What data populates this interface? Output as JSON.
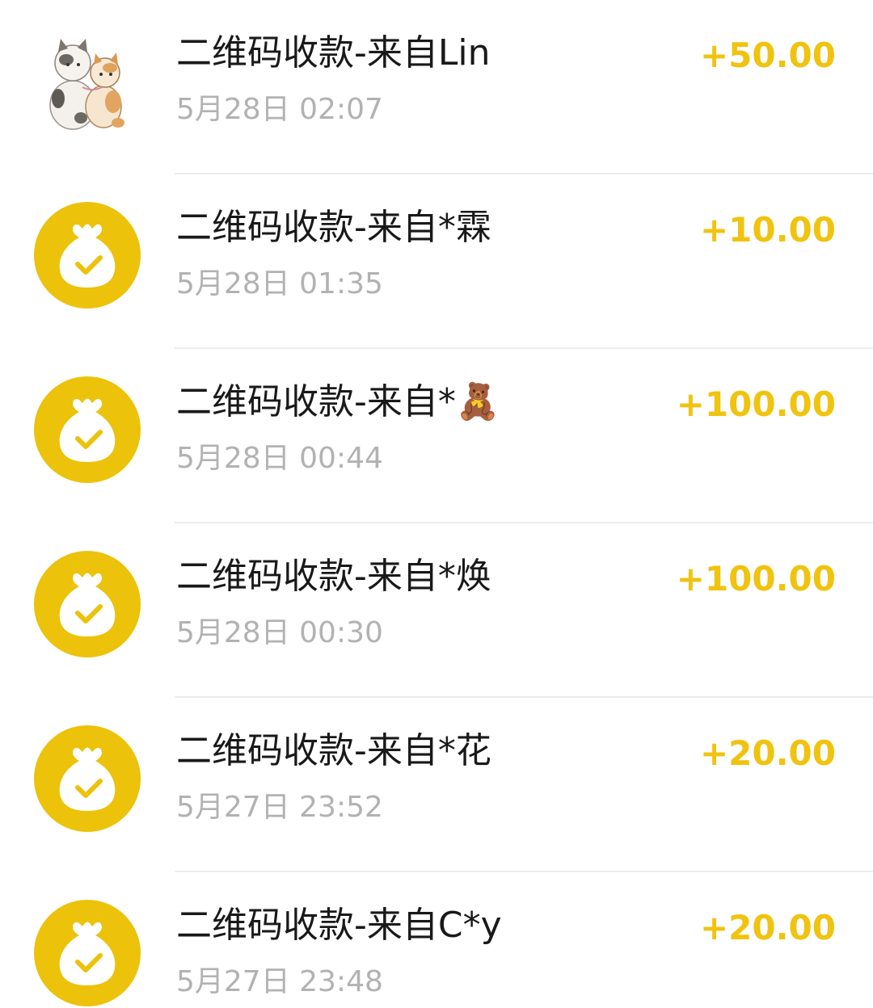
{
  "colors": {
    "accent": "#F0C30F",
    "title_text": "#191919",
    "time_text": "#B2B2B2",
    "divider": "#ECECEC"
  },
  "transactions": [
    {
      "avatar": "cat-photo-avatar",
      "title": "二维码收款-来自Lin",
      "time": "5月28日 02:07",
      "amount": "+50.00"
    },
    {
      "avatar": "money-bag-icon",
      "title": "二维码收款-来自*霖",
      "time": "5月28日 01:35",
      "amount": "+10.00"
    },
    {
      "avatar": "money-bag-icon",
      "title": "二维码收款-来自*🧸",
      "time": "5月28日 00:44",
      "amount": "+100.00"
    },
    {
      "avatar": "money-bag-icon",
      "title": "二维码收款-来自*焕",
      "time": "5月28日 00:30",
      "amount": "+100.00"
    },
    {
      "avatar": "money-bag-icon",
      "title": "二维码收款-来自*花",
      "time": "5月27日 23:52",
      "amount": "+20.00"
    },
    {
      "avatar": "money-bag-icon",
      "title": "二维码收款-来自C*y",
      "time": "5月27日 23:48",
      "amount": "+20.00"
    }
  ]
}
